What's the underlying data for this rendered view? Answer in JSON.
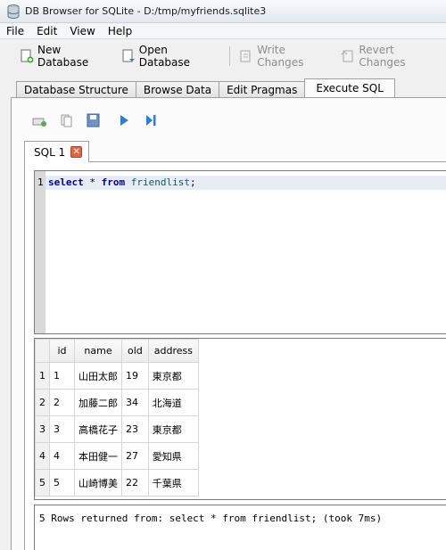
{
  "window": {
    "title": "DB Browser for SQLite - D:/tmp/myfriends.sqlite3"
  },
  "menu": [
    "File",
    "Edit",
    "View",
    "Help"
  ],
  "toolbar": {
    "new_database": "New Database",
    "open_database": "Open Database",
    "write_changes": "Write Changes",
    "revert_changes": "Revert Changes"
  },
  "tabs": [
    "Database Structure",
    "Browse Data",
    "Edit Pragmas",
    "Execute SQL"
  ],
  "sql_tab": {
    "label": "SQL 1"
  },
  "editor": {
    "line_number": "1",
    "keyword_select": "select",
    "star": " * ",
    "keyword_from": "from",
    "table": "friendlist",
    "semicolon": ";"
  },
  "results": {
    "columns": [
      "id",
      "name",
      "old",
      "address"
    ],
    "rows": [
      {
        "n": "1",
        "id": "1",
        "name": "山田太郎",
        "old": "19",
        "address": "東京都"
      },
      {
        "n": "2",
        "id": "2",
        "name": "加藤二郎",
        "old": "34",
        "address": "北海道"
      },
      {
        "n": "3",
        "id": "3",
        "name": "高橋花子",
        "old": "23",
        "address": "東京都"
      },
      {
        "n": "4",
        "id": "4",
        "name": "本田健一",
        "old": "27",
        "address": "愛知県"
      },
      {
        "n": "5",
        "id": "5",
        "name": "山崎博美",
        "old": "22",
        "address": "千葉県"
      }
    ]
  },
  "status": {
    "message": "5 Rows returned from: select * from friendlist; (took 7ms)"
  }
}
